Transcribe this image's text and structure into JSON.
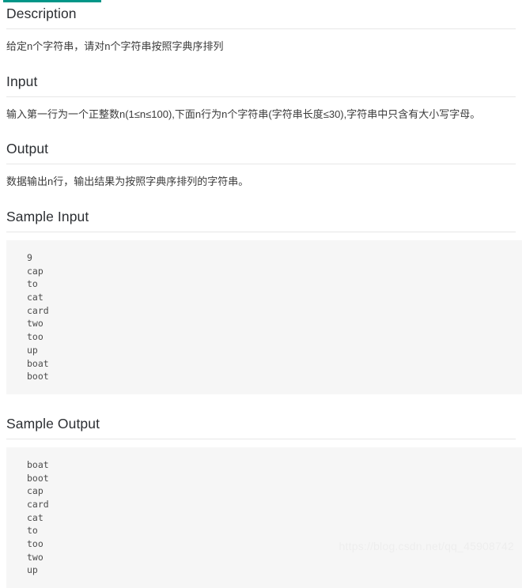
{
  "accent_color": "#009688",
  "sections": [
    {
      "heading": "Description",
      "body": "给定n个字符串，请对n个字符串按照字典序排列"
    },
    {
      "heading": "Input",
      "body": "输入第一行为一个正整数n(1≤n≤100),下面n行为n个字符串(字符串长度≤30),字符串中只含有大小写字母。"
    },
    {
      "heading": "Output",
      "body": "数据输出n行，输出结果为按照字典序排列的字符串。"
    }
  ],
  "sample_input": {
    "heading": "Sample Input",
    "lines": [
      "9",
      "cap",
      "to",
      "cat",
      "card",
      "two",
      "too",
      "up",
      "boat",
      "boot"
    ],
    "text": "9\ncap\nto\ncat\ncard\ntwo\ntoo\nup\nboat\nboot"
  },
  "sample_output": {
    "heading": "Sample Output",
    "lines": [
      "boat",
      "boot",
      "cap",
      "card",
      "cat",
      "to",
      "too",
      "two",
      "up"
    ],
    "text": "boat\nboot\ncap\ncard\ncat\nto\ntoo\ntwo\nup"
  },
  "watermark": "https://blog.csdn.net/qq_45908742"
}
